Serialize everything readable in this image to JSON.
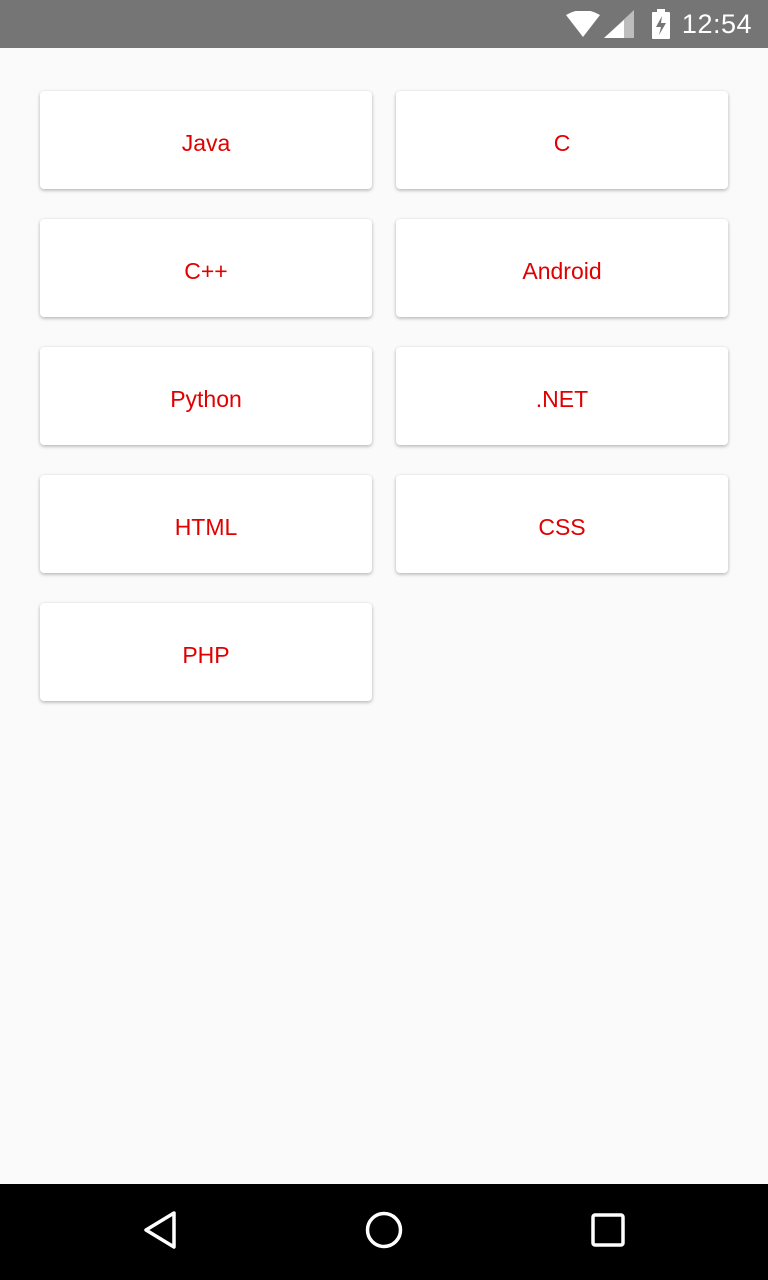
{
  "status_bar": {
    "time": "12:54",
    "icons": [
      "wifi-icon",
      "signal-icon",
      "battery-charging-icon"
    ]
  },
  "grid": {
    "items": [
      {
        "label": "Java"
      },
      {
        "label": "C"
      },
      {
        "label": "C++"
      },
      {
        "label": "Android"
      },
      {
        "label": "Python"
      },
      {
        "label": ".NET"
      },
      {
        "label": "HTML"
      },
      {
        "label": "CSS"
      },
      {
        "label": "PHP"
      }
    ]
  },
  "nav_bar": {
    "icons": [
      "back-icon",
      "home-icon",
      "recents-icon"
    ]
  },
  "colors": {
    "label_text": "#e00000",
    "status_bar_bg": "#757575",
    "nav_bar_bg": "#000000",
    "page_bg": "#fafafa",
    "card_bg": "#ffffff"
  }
}
